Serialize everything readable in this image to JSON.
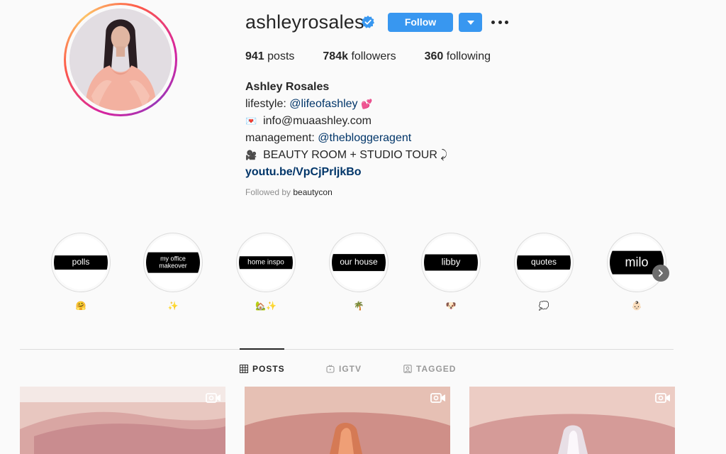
{
  "profile": {
    "username": "ashleyrosales",
    "follow_label": "Follow",
    "stats": {
      "posts_count": "941",
      "posts_label": "posts",
      "followers_count": "784k",
      "followers_label": "followers",
      "following_count": "360",
      "following_label": "following"
    },
    "bio": {
      "name": "Ashley Rosales",
      "line1_prefix": "lifestyle: ",
      "line1_link": "@lifeofashley",
      "line1_emoji": "💕",
      "line2_emoji": "💌",
      "line2_text": "info@muaashley.com",
      "line3_prefix": "management: ",
      "line3_link": "@thebloggeragent",
      "line4_emoji": "🎥",
      "line4_text": "BEAUTY ROOM + STUDIO TOUR ⤸",
      "url": "youtu.be/VpCjPrljkBo"
    },
    "followed_by_label": "Followed by",
    "followed_by_user": "beautycon"
  },
  "highlights": [
    {
      "cover_text": "polls",
      "emoji": "🤗"
    },
    {
      "cover_text": "my office makeover",
      "emoji": "✨"
    },
    {
      "cover_text": "home inspo",
      "emoji": "🏡✨"
    },
    {
      "cover_text": "our house",
      "emoji": "🌴"
    },
    {
      "cover_text": "libby",
      "emoji": "🐶"
    },
    {
      "cover_text": "quotes",
      "emoji": "💭"
    },
    {
      "cover_text": "milo",
      "emoji": "👶🏻"
    }
  ],
  "tabs": [
    {
      "label": "POSTS",
      "active": true
    },
    {
      "label": "IGTV",
      "active": false
    },
    {
      "label": "TAGGED",
      "active": false
    }
  ],
  "colors": {
    "accent": "#3897f0",
    "link": "#003569",
    "text": "#262626",
    "muted": "#8e8e8e"
  },
  "icons": [
    "verified-badge-icon",
    "chevron-down-icon",
    "more-icon",
    "chevron-right-icon",
    "grid-icon",
    "igtv-icon",
    "tagged-icon",
    "video-icon"
  ]
}
